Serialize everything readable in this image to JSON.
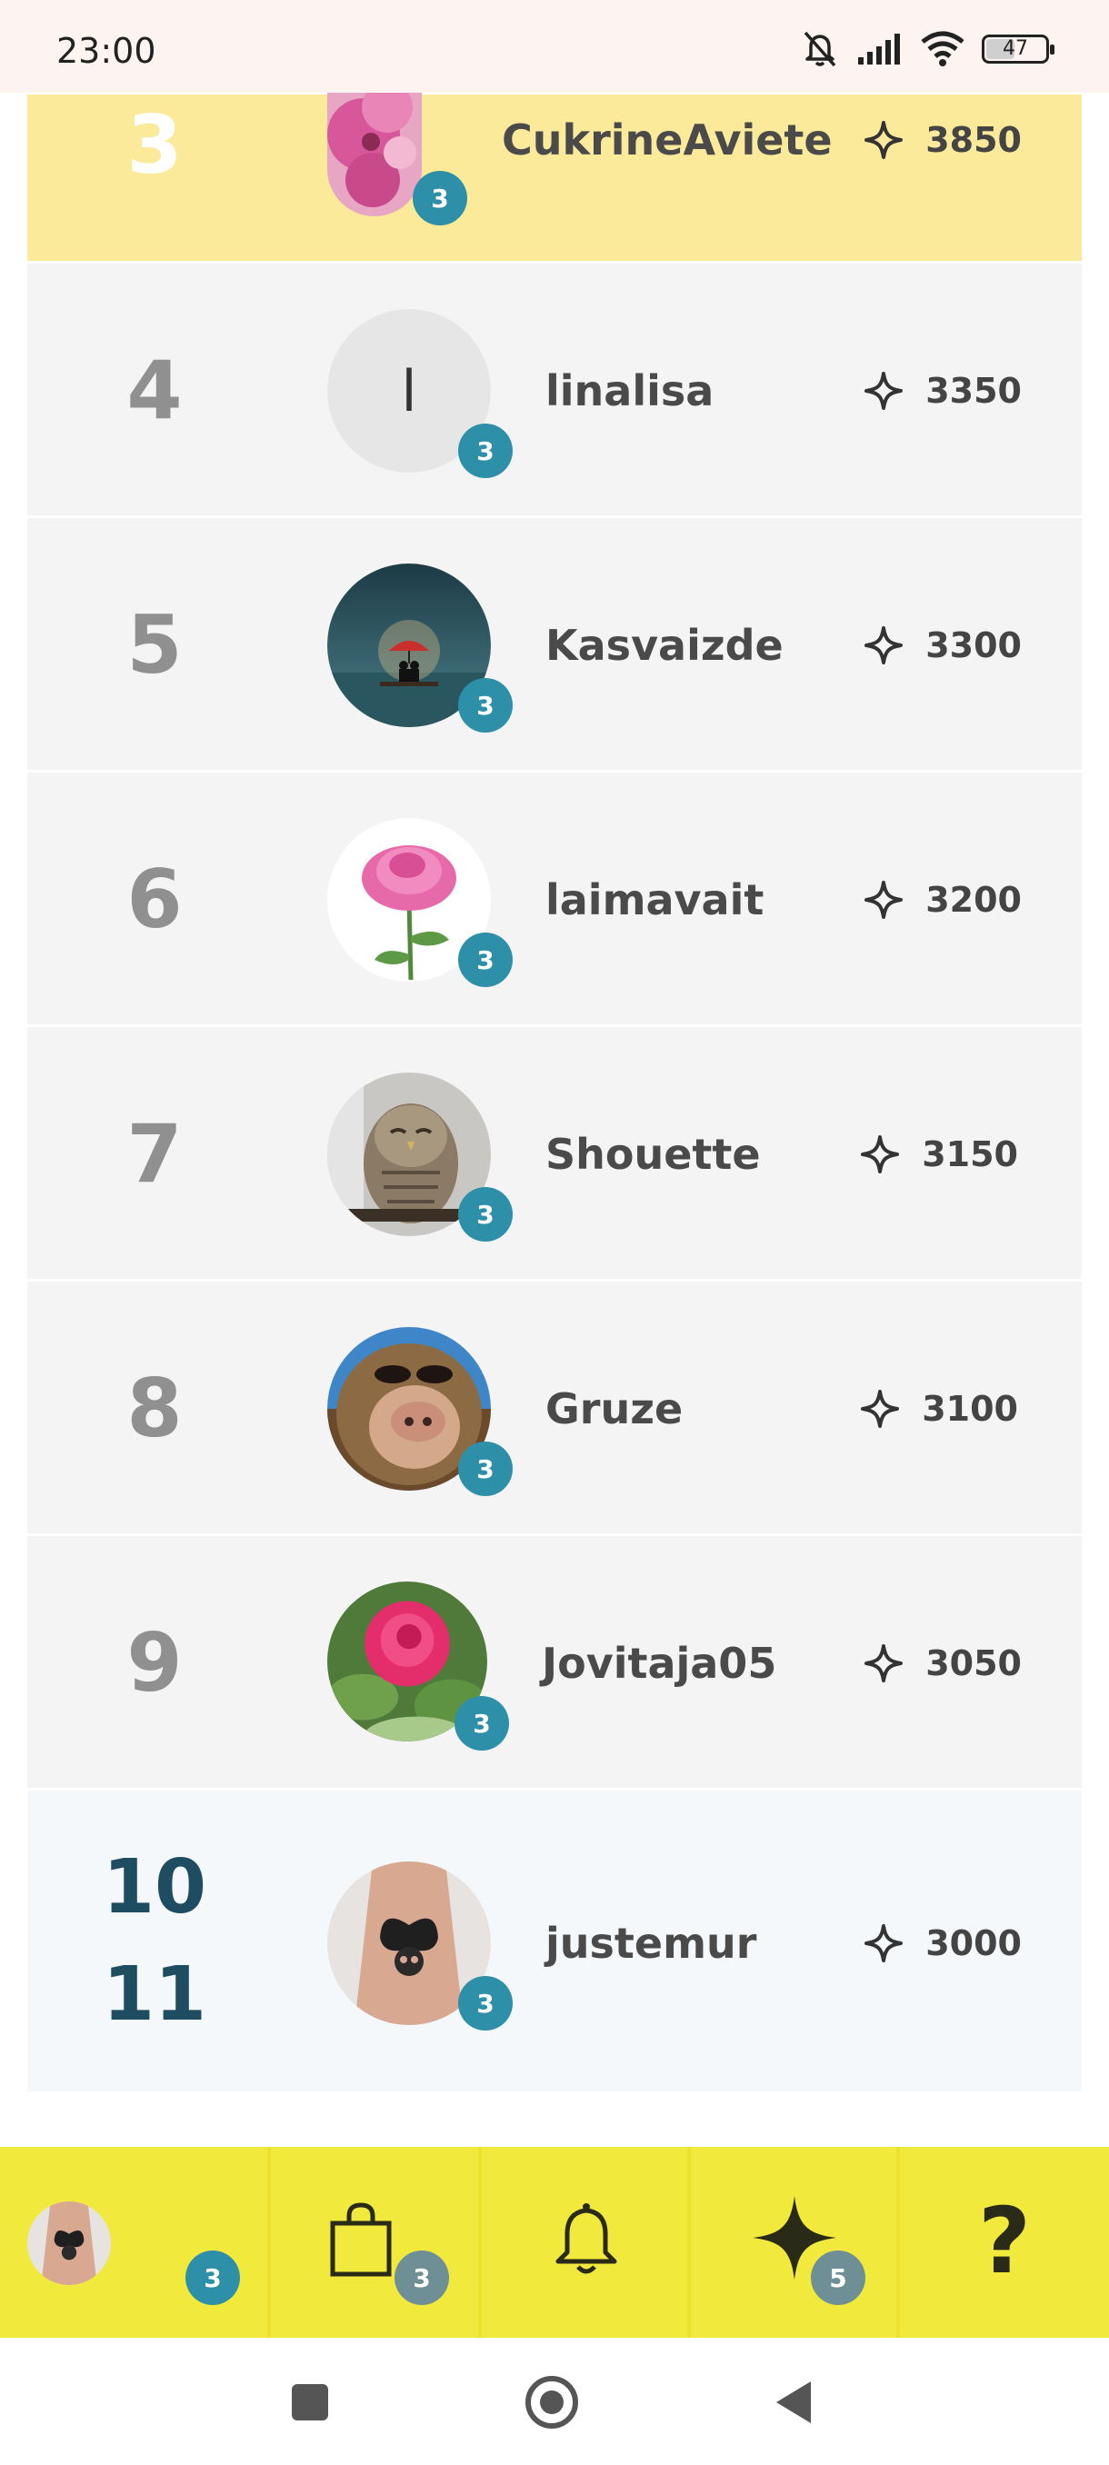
{
  "status_bar": {
    "time": "23:00",
    "icons": [
      "bell-off-icon",
      "signal-icon",
      "wifi-icon",
      "battery-icon"
    ],
    "battery": "47"
  },
  "leaderboard": [
    {
      "rank": "3",
      "username": "CukrineAviete",
      "points": "3850",
      "badge": "3",
      "avatar": "pink-flower-avatar",
      "highlight": "gold"
    },
    {
      "rank": "4",
      "username": "linalisa",
      "points": "3350",
      "badge": "3",
      "avatar": "initial-avatar",
      "initial": "l"
    },
    {
      "rank": "5",
      "username": "Kasvaizde",
      "points": "3300",
      "badge": "3",
      "avatar": "rain-umbrella-avatar"
    },
    {
      "rank": "6",
      "username": "laimavait",
      "points": "3200",
      "badge": "3",
      "avatar": "peony-avatar"
    },
    {
      "rank": "7",
      "username": "Shouette",
      "points": "3150",
      "badge": "3",
      "avatar": "owl-avatar"
    },
    {
      "rank": "8",
      "username": "Gruze",
      "points": "3100",
      "badge": "3",
      "avatar": "puppet-avatar"
    },
    {
      "rank": "9",
      "username": "Jovitaja05",
      "points": "3050",
      "badge": "3",
      "avatar": "rose-avatar"
    },
    {
      "rank": "10",
      "rank_line2": "11",
      "username": "justemur",
      "points": "3000",
      "badge": "3",
      "avatar": "tattoo-avatar",
      "highlight": "me"
    }
  ],
  "bottom_nav": {
    "profile_badge": "3",
    "shop_badge": "3",
    "points_badge": "5",
    "help_label": "?"
  },
  "colors": {
    "gold_row": "#fcea9b",
    "badge": "#2e8fa8",
    "nav_bar": "#f2e93d",
    "grey_badge": "#6f8f96"
  }
}
